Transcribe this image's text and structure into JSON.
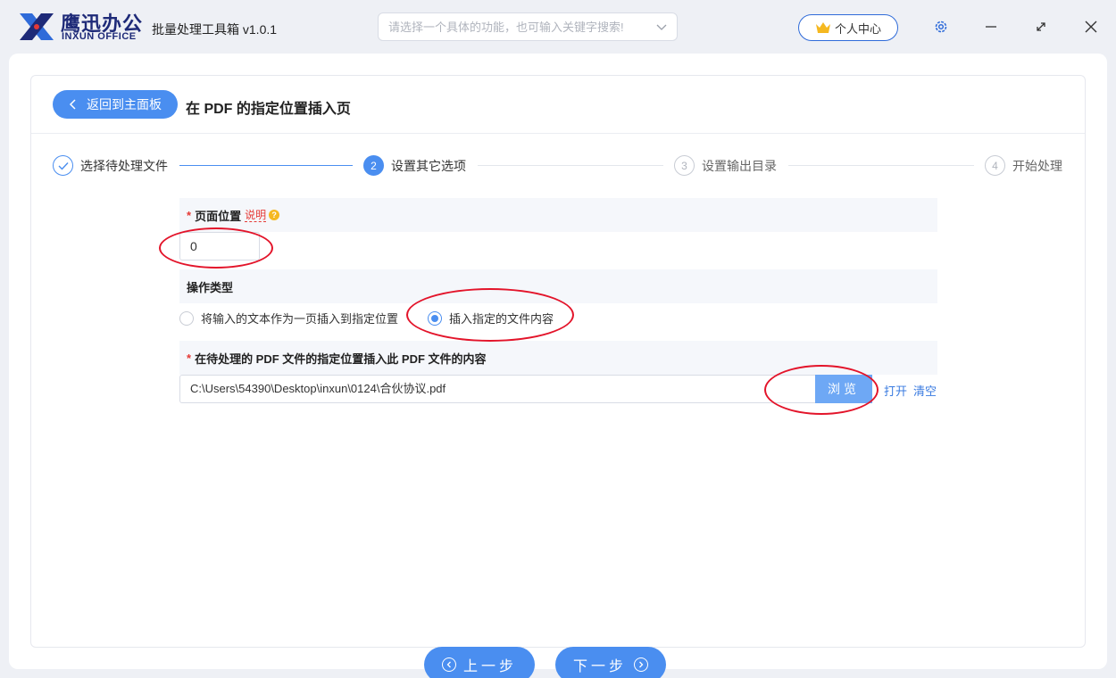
{
  "app": {
    "brand_cn": "鹰迅办公",
    "brand_en": "INXUN OFFICE",
    "title": "批量处理工具箱 v1.0.1",
    "search_placeholder": "请选择一个具体的功能，也可输入关键字搜索!",
    "user_center": "个人中心",
    "icons": [
      "logo-x-icon",
      "chevron-down-icon",
      "crown-icon",
      "gear-icon",
      "minimize-icon",
      "maximize-icon",
      "close-icon"
    ]
  },
  "header": {
    "back_label": "返回到主面板",
    "page_title": "在 PDF 的指定位置插入页"
  },
  "steps": [
    {
      "num": "1",
      "label": "选择待处理文件",
      "state": "done"
    },
    {
      "num": "2",
      "label": "设置其它选项",
      "state": "active"
    },
    {
      "num": "3",
      "label": "设置输出目录",
      "state": "pending"
    },
    {
      "num": "4",
      "label": "开始处理",
      "state": "pending"
    }
  ],
  "form": {
    "page_position": {
      "label": "页面位置",
      "hint": "说明",
      "value": "0"
    },
    "operation": {
      "label": "操作类型",
      "options": [
        {
          "label": "将输入的文本作为一页插入到指定位置",
          "checked": false
        },
        {
          "label": "插入指定的文件内容",
          "checked": true
        }
      ]
    },
    "insert_file": {
      "label": "在待处理的 PDF 文件的指定位置插入此 PDF 文件的内容",
      "path": "C:\\Users\\54390\\Desktop\\inxun\\0124\\合伙协议.pdf",
      "browse": "浏览",
      "open": "打开",
      "clear": "清空"
    }
  },
  "footer": {
    "prev": "上一步",
    "next": "下一步"
  },
  "colors": {
    "accent": "#4a8ef0",
    "annotation": "#e3142a",
    "brand": "#1e2a78"
  }
}
